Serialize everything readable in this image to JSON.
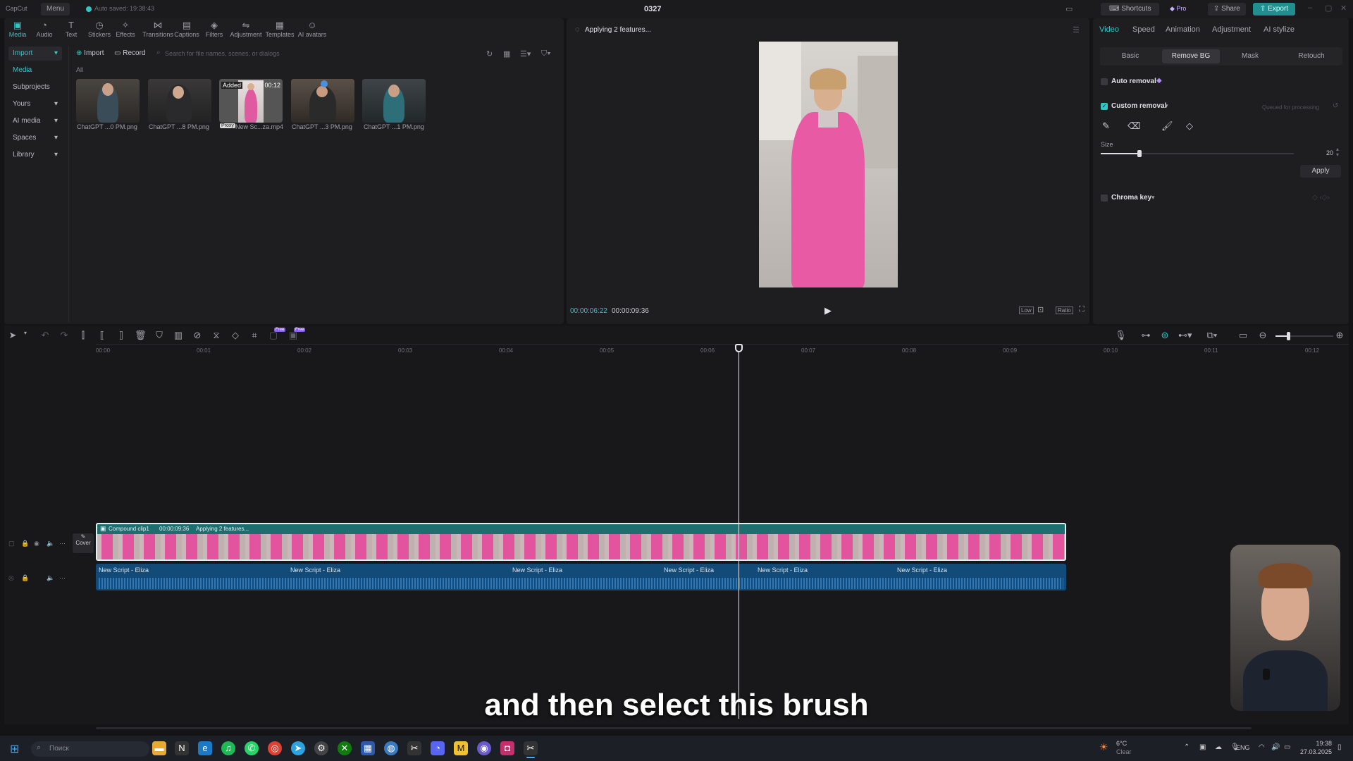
{
  "app": {
    "logo": "CapCut",
    "menu_label": "Menu",
    "autosave": "Auto saved: 19:38:43",
    "project_title": "0327",
    "shortcuts_label": "Shortcuts",
    "pro_label": "Pro",
    "share_label": "Share",
    "export_label": "Export",
    "accent_color": "#2fc6c6"
  },
  "toolbar": {
    "items": [
      {
        "label": "Media",
        "icon": "media-icon"
      },
      {
        "label": "Audio",
        "icon": "audio-icon"
      },
      {
        "label": "Text",
        "icon": "text-icon"
      },
      {
        "label": "Stickers",
        "icon": "stickers-icon"
      },
      {
        "label": "Effects",
        "icon": "effects-icon"
      },
      {
        "label": "Transitions",
        "icon": "transitions-icon"
      },
      {
        "label": "Captions",
        "icon": "captions-icon"
      },
      {
        "label": "Filters",
        "icon": "filters-icon"
      },
      {
        "label": "Adjustment",
        "icon": "adjustment-icon"
      },
      {
        "label": "Templates",
        "icon": "templates-icon"
      },
      {
        "label": "AI avatars",
        "icon": "ai-avatars-icon"
      }
    ]
  },
  "sidebar": {
    "items": [
      {
        "label": "Import"
      },
      {
        "label": "Media"
      },
      {
        "label": "Subprojects"
      },
      {
        "label": "Yours"
      },
      {
        "label": "AI media"
      },
      {
        "label": "Spaces"
      },
      {
        "label": "Library"
      }
    ]
  },
  "media": {
    "import_label": "Import",
    "record_label": "Record",
    "search_placeholder": "Search for file names, scenes, or dialogs",
    "filter_all": "All",
    "assets": [
      {
        "name": "ChatGPT ...0 PM.png"
      },
      {
        "name": "ChatGPT ...8 PM.png"
      },
      {
        "name": "New Sc...za.mp4",
        "badge_added": "Added",
        "duration": "00:12",
        "badge_proxy": "Proxy"
      },
      {
        "name": "ChatGPT ...3 PM.png"
      },
      {
        "name": "ChatGPT ...1 PM.png"
      }
    ]
  },
  "player": {
    "status": "Applying 2 features...",
    "current_time": "00:00:06:22",
    "total_time": "00:00:09:36",
    "quality_label": "Low",
    "ratio_label": "Ratio"
  },
  "properties": {
    "tabs": [
      "Video",
      "Speed",
      "Animation",
      "Adjustment",
      "AI stylize"
    ],
    "subtabs": [
      "Basic",
      "Remove BG",
      "Mask",
      "Retouch"
    ],
    "auto_removal": "Auto removal",
    "custom_removal": "Custom removal",
    "queued": "Queued for processing",
    "size_label": "Size",
    "size_value": "20",
    "size_fraction": 0.2,
    "apply_label": "Apply",
    "chroma_key": "Chroma key"
  },
  "timeline": {
    "ticks": [
      "00:00",
      "00:01",
      "00:02",
      "00:03",
      "00:04",
      "00:05",
      "00:06",
      "00:07",
      "00:08",
      "00:09",
      "00:10",
      "00:11",
      "00:12"
    ],
    "free_badge": "Free",
    "cover_label": "Cover",
    "clip_name": "Compound clip1",
    "clip_duration": "00:00:09:36",
    "clip_status": "Applying 2 features...",
    "audio_clips": [
      "New Script - Eliza",
      "New Script - Eliza",
      "New Script - Eliza",
      "New Script - Eliza",
      "New Script - Eliza",
      "New Script - Eliza"
    ]
  },
  "subtitle": "and then select this brush",
  "taskbar": {
    "search_placeholder": "Поиск",
    "weather_temp": "6°C",
    "weather_text": "Clear",
    "lang": "ENG",
    "time": "19:38",
    "date": "27.03.2025"
  }
}
